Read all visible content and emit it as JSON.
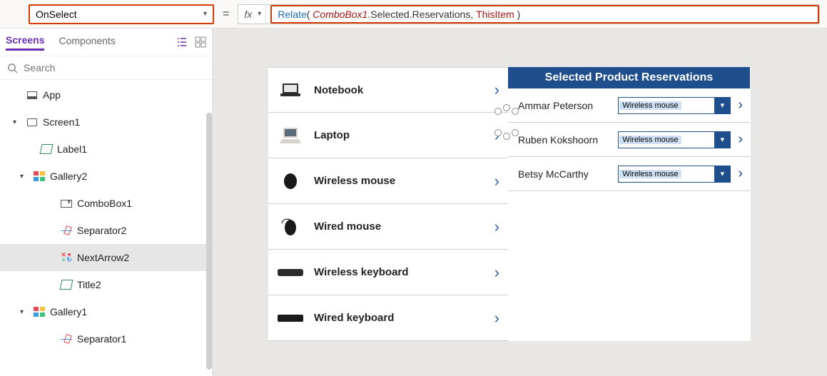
{
  "property_selector": {
    "value": "OnSelect"
  },
  "formula_bar": {
    "fx": "fx",
    "tokens": {
      "fn": "Relate",
      "open": "( ",
      "obj": "ComboBox1",
      "dot1": ".Selected.Reservations",
      "comma": ", ",
      "this": "ThisItem",
      "close": " )"
    }
  },
  "left_panel": {
    "tabs": {
      "screens": "Screens",
      "components": "Components"
    },
    "search_placeholder": "Search",
    "tree": {
      "app": "App",
      "screen1": "Screen1",
      "label1": "Label1",
      "gallery2": "Gallery2",
      "combobox1": "ComboBox1",
      "separator2": "Separator2",
      "nextarrow2": "NextArrow2",
      "title2": "Title2",
      "gallery1": "Gallery1",
      "separator1": "Separator1"
    }
  },
  "canvas": {
    "products": [
      {
        "label": "Notebook"
      },
      {
        "label": "Laptop"
      },
      {
        "label": "Wireless mouse"
      },
      {
        "label": "Wired mouse"
      },
      {
        "label": "Wireless keyboard"
      },
      {
        "label": "Wired keyboard"
      }
    ],
    "reservations_header": "Selected Product Reservations",
    "reservations": [
      {
        "name": "Ammar Peterson",
        "product": "Wireless mouse"
      },
      {
        "name": "Ruben Kokshoorn",
        "product": "Wireless mouse"
      },
      {
        "name": "Betsy McCarthy",
        "product": "Wireless mouse"
      }
    ]
  }
}
